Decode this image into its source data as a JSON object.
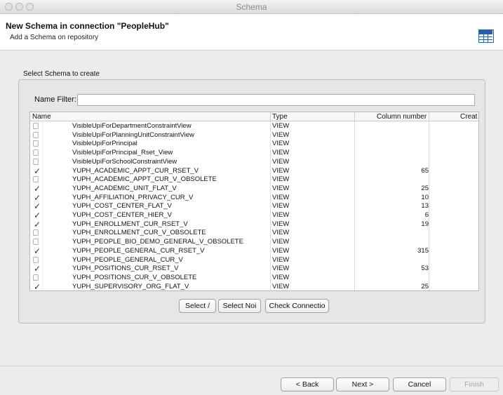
{
  "window": {
    "title": "Schema"
  },
  "header": {
    "title": "New Schema in connection \"PeopleHub\"",
    "subtitle": "Add a Schema on repository",
    "icon": "table-grid-icon",
    "accent": "#2a5fa8"
  },
  "section": {
    "label": "Select Schema to create"
  },
  "filter": {
    "label": "Name Filter:",
    "value": "",
    "placeholder": ""
  },
  "table": {
    "columns": [
      "Name",
      "Type",
      "Column number",
      "Creat"
    ],
    "rows": [
      {
        "checked": false,
        "name": "VisibleUpiForDepartmentConstraintView",
        "type": "VIEW",
        "columns": ""
      },
      {
        "checked": false,
        "name": "VisibleUpiForPlanningUnitConstraintView",
        "type": "VIEW",
        "columns": ""
      },
      {
        "checked": false,
        "name": "VisibleUpiForPrincipal",
        "type": "VIEW",
        "columns": ""
      },
      {
        "checked": false,
        "name": "VisibleUpiForPrincipal_Rset_View",
        "type": "VIEW",
        "columns": ""
      },
      {
        "checked": false,
        "name": "VisibleUpiForSchoolConstraintView",
        "type": "VIEW",
        "columns": ""
      },
      {
        "checked": true,
        "name": "YUPH_ACADEMIC_APPT_CUR_RSET_V",
        "type": "VIEW",
        "columns": "65"
      },
      {
        "checked": false,
        "name": "YUPH_ACADEMIC_APPT_CUR_V_OBSOLETE",
        "type": "VIEW",
        "columns": ""
      },
      {
        "checked": true,
        "name": "YUPH_ACADEMIC_UNIT_FLAT_V",
        "type": "VIEW",
        "columns": "25"
      },
      {
        "checked": true,
        "name": "YUPH_AFFILIATION_PRIVACY_CUR_V",
        "type": "VIEW",
        "columns": "10"
      },
      {
        "checked": true,
        "name": "YUPH_COST_CENTER_FLAT_V",
        "type": "VIEW",
        "columns": "13"
      },
      {
        "checked": true,
        "name": "YUPH_COST_CENTER_HIER_V",
        "type": "VIEW",
        "columns": "6"
      },
      {
        "checked": true,
        "name": "YUPH_ENROLLMENT_CUR_RSET_V",
        "type": "VIEW",
        "columns": "19"
      },
      {
        "checked": false,
        "name": "YUPH_ENROLLMENT_CUR_V_OBSOLETE",
        "type": "VIEW",
        "columns": ""
      },
      {
        "checked": false,
        "name": "YUPH_PEOPLE_BIO_DEMO_GENERAL_V_OBSOLETE",
        "type": "VIEW",
        "columns": ""
      },
      {
        "checked": true,
        "name": "YUPH_PEOPLE_GENERAL_CUR_RSET_V",
        "type": "VIEW",
        "columns": "315"
      },
      {
        "checked": false,
        "name": "YUPH_PEOPLE_GENERAL_CUR_V",
        "type": "VIEW",
        "columns": ""
      },
      {
        "checked": true,
        "name": "YUPH_POSITIONS_CUR_RSET_V",
        "type": "VIEW",
        "columns": "53"
      },
      {
        "checked": false,
        "name": "YUPH_POSITIONS_CUR_V_OBSOLETE",
        "type": "VIEW",
        "columns": ""
      },
      {
        "checked": true,
        "name": "YUPH_SUPERVISORY_ORG_FLAT_V",
        "type": "VIEW",
        "columns": "25"
      }
    ],
    "check_glyph": "✓"
  },
  "actions": {
    "select_all": "Select /",
    "select_none": "Select Noi",
    "check_connection": "Check Connectio"
  },
  "footer": {
    "back": "< Back",
    "next": "Next >",
    "cancel": "Cancel",
    "finish": "Finish"
  }
}
